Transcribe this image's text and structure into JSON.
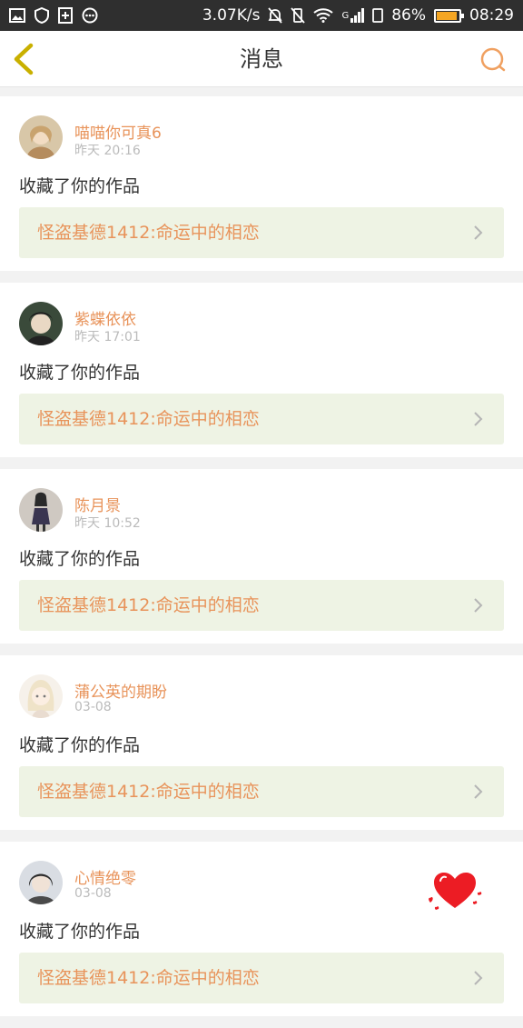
{
  "status_bar": {
    "speed": "3.07K/s",
    "network": "G",
    "battery": "86%",
    "time": "08:29"
  },
  "header": {
    "title": "消息"
  },
  "messages": [
    {
      "user": "喵喵你可真6",
      "time": "昨天  20:16",
      "action": "收藏了你的作品",
      "work": "怪盗基德1412:命运中的相恋"
    },
    {
      "user": "紫蝶依依",
      "time": "昨天  17:01",
      "action": "收藏了你的作品",
      "work": "怪盗基德1412:命运中的相恋"
    },
    {
      "user": "陈月景",
      "time": "昨天  10:52",
      "action": "收藏了你的作品",
      "work": "怪盗基德1412:命运中的相恋"
    },
    {
      "user": "蒲公英的期盼",
      "time": "03-08",
      "action": "收藏了你的作品",
      "work": "怪盗基德1412:命运中的相恋"
    },
    {
      "user": "心情绝零",
      "time": "03-08",
      "action": "收藏了你的作品",
      "work": "怪盗基德1412:命运中的相恋"
    }
  ],
  "colors": {
    "accent": "#e8935a",
    "back_icon": "#c9b000",
    "link_bg": "#eef3e4"
  },
  "icons": {
    "back": "chevron-left-icon",
    "search": "search-icon",
    "floating": "heart-icon"
  }
}
